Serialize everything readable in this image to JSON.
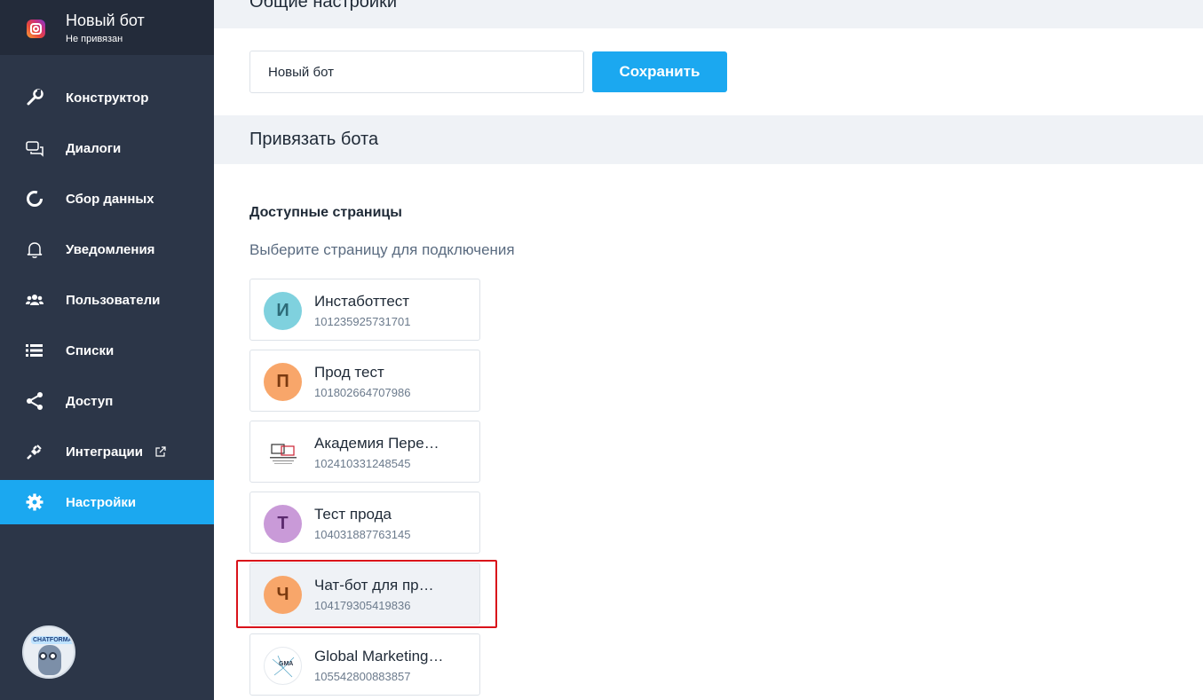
{
  "bot": {
    "name": "Новый бот",
    "status": "Не привязан"
  },
  "sidebar": {
    "items": [
      {
        "label": "Конструктор",
        "icon": "wrench-icon"
      },
      {
        "label": "Диалоги",
        "icon": "chat-icon"
      },
      {
        "label": "Сбор данных",
        "icon": "circle-progress-icon"
      },
      {
        "label": "Уведомления",
        "icon": "bell-icon"
      },
      {
        "label": "Пользователи",
        "icon": "users-icon"
      },
      {
        "label": "Списки",
        "icon": "list-icon"
      },
      {
        "label": "Доступ",
        "icon": "share-icon"
      },
      {
        "label": "Интеграции",
        "icon": "plug-icon"
      },
      {
        "label": "Настройки",
        "icon": "gear-icon",
        "active": true
      }
    ],
    "assistant_badge": "CHATFORMA"
  },
  "general": {
    "title": "Общие настройки",
    "name_value": "Новый бот",
    "save_label": "Сохранить"
  },
  "bind": {
    "title": "Привязать бота",
    "available_title": "Доступные страницы",
    "hint": "Выберите страницу для подключения",
    "pages": [
      {
        "initial": "И",
        "name": "Инстаботтест",
        "id": "101235925731701",
        "color": "#7fd1de",
        "text_color": "#2d6b78"
      },
      {
        "initial": "П",
        "name": "Прод тест",
        "id": "101802664707986",
        "color": "#f8a66a",
        "text_color": "#7a3a10"
      },
      {
        "initial": "",
        "name": "Академия Пере…",
        "id": "102410331248545",
        "logo": true
      },
      {
        "initial": "Т",
        "name": "Тест прода",
        "id": "104031887763145",
        "color": "#c99ad8",
        "text_color": "#5b2a6e"
      },
      {
        "initial": "Ч",
        "name": "Чат-бот для пр…",
        "id": "104179305419836",
        "color": "#f8a66a",
        "text_color": "#7a3a10",
        "selected": true
      },
      {
        "initial": "",
        "name": "Global Marketing…",
        "id": "105542800883857",
        "logo": true,
        "logo_text": "GMA"
      }
    ]
  },
  "colors": {
    "sidebar_bg": "#2c3648",
    "accent": "#1ba8f0",
    "highlight": "#d9121a"
  }
}
